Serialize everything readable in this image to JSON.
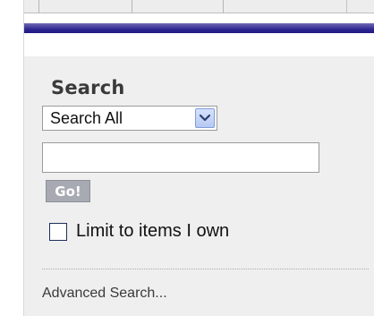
{
  "search": {
    "title": "Search",
    "scope_selected": "Search All",
    "query_value": "",
    "go_label": "Go!",
    "limit_label": "Limit to items I own",
    "limit_checked": false,
    "advanced_label": "Advanced Search..."
  },
  "icons": {
    "dropdown": "chevron-down-icon"
  },
  "colors": {
    "accent_bar": "#2b2490",
    "panel_bg": "#efefef",
    "go_button_bg": "#a8aab3",
    "dropdown_button_bg": "#b6c9f3"
  }
}
